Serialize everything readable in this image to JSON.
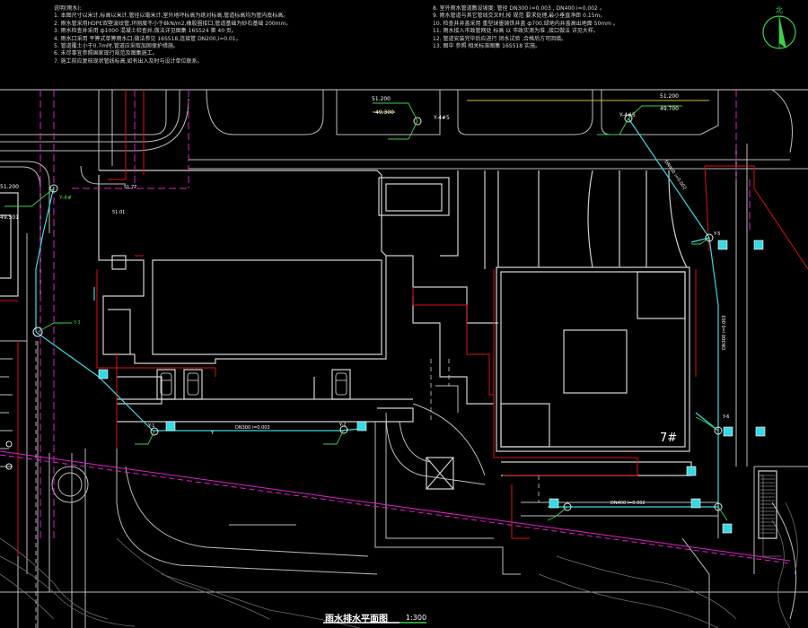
{
  "notes_left": [
    "说明(雨水):",
    "1. 本图尺寸以米计,标高以米计,管径以毫米计,室外地坪标高为绝对标高,管道标高均为管内底标高。",
    "2. 雨水管采用HDPE双壁波纹管,环刚度不小于8kN/m2,橡胶圈接口,管道基础为砂石基础 200mm。",
    "3. 雨水检查井采用 ф1000 混凝土检查井,做法详见图集 16S524 第 40 页。",
    "4. 雨水口采用 平箅式单箅雨水口,做法参见 16S518,连接管 DN200,i=0.01。",
    "5. 管道覆土小于0.7m时,管道应采取加固保护措施。",
    "6. 未尽事宜参照国家现行规范及图集施工。",
    "7. 施工前应复核现状管线标高,如有出入及时与设计单位联系。"
  ],
  "notes_right": [
    "8. 室外雨水管道敷设坡度: 管径 DN300 i=0.003 , DN400 i=0.002 。",
    "9. 雨水管道与其它管线交叉时,按 规范 要求处理,最小垂直净距 0.15m。",
    "10. 检查井井盖采用 重型球墨铸铁井盖 ф700,绿地内井盖高出地面 50mm 。",
    "11. 雨水接入市政管网处 标高 以 市政实测为准 ,接口做法 详见大样。",
    "12. 管道安装完毕后应进行 闭水试验 ,合格后方可回填。",
    "13. 图中 参照 相关标准图集 16S518 实施。"
  ],
  "labels": {
    "elev_top1": "51.200",
    "elev_top1b": "49.300",
    "well_top1": "Y-4#5",
    "elev_top2": "51.200",
    "elev_top2b": "49.700",
    "well_top2": "Y-4#5",
    "elev_left": "51.200",
    "elev_left_b": "49.501",
    "well_left": "Y-4#",
    "well_y3": "Y-3",
    "well_y1": "Y-1",
    "well_y2": "Y-2",
    "well_y5": "Y-5",
    "well_y6": "Y-6",
    "pipe_mid": "DN300 i=0.003",
    "pipe_bottom": "DN400 i=0.002",
    "pipe_right": "DN300 i=0.003",
    "pipe_top_right": "DN400 i=0.002",
    "building_no": "7#",
    "north": "北",
    "spot_1": "51.77",
    "spot_2": "51.01",
    "y_letter": "Y"
  },
  "title": "雨水排水平面图",
  "scale": "1:300",
  "colors": {
    "background": "#000000",
    "wall": "#c8c8c8",
    "rain_pipe": "#3ad8e0",
    "red_line": "#e01010",
    "magenta_line": "#e020c8",
    "green_label": "#3cd24a",
    "yellow_line": "#d8c020"
  }
}
